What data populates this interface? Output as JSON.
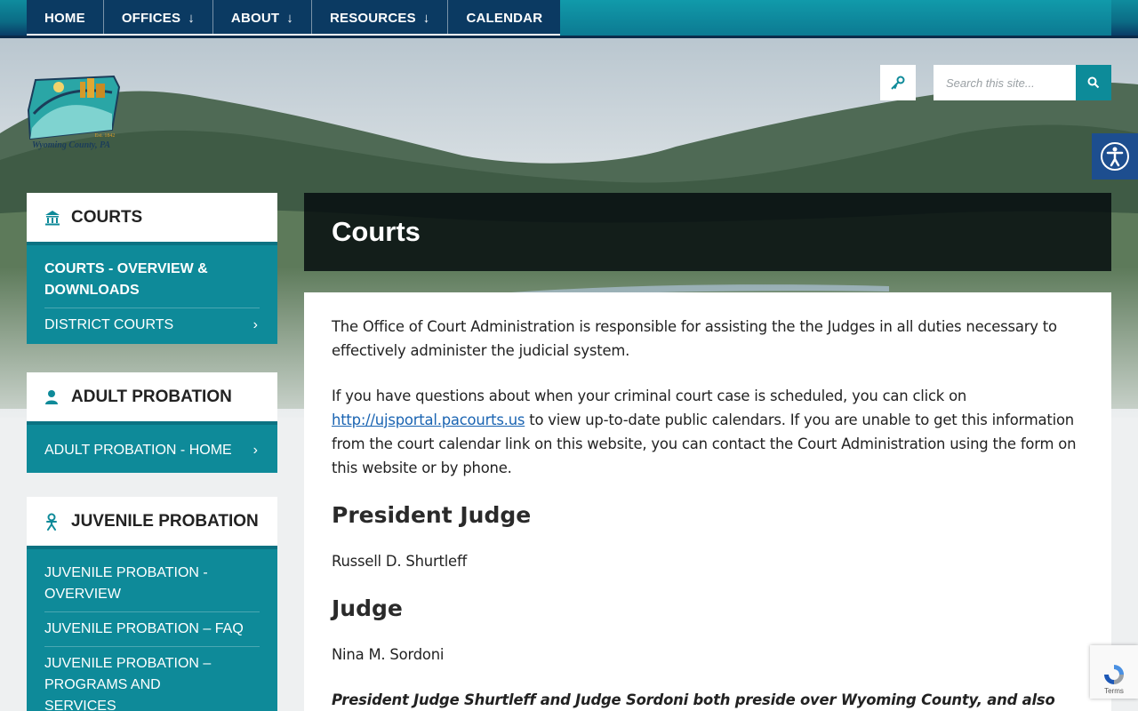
{
  "nav": {
    "items": [
      {
        "label": "HOME",
        "dropdown": false
      },
      {
        "label": "OFFICES",
        "dropdown": true
      },
      {
        "label": "ABOUT",
        "dropdown": true
      },
      {
        "label": "RESOURCES",
        "dropdown": true
      },
      {
        "label": "CALENDAR",
        "dropdown": false
      }
    ]
  },
  "logo": {
    "text": "Wyoming County, PA",
    "est": "Est. 1842"
  },
  "search": {
    "placeholder": "Search this site..."
  },
  "sidebar": {
    "courts": {
      "heading": "COURTS",
      "icon": "courthouse-icon",
      "links": [
        {
          "label": "COURTS - OVERVIEW & DOWNLOADS",
          "active": true
        },
        {
          "label": "DISTRICT COURTS",
          "active": false,
          "chevron": true
        }
      ]
    },
    "adult_probation": {
      "heading": "ADULT PROBATION",
      "icon": "user-icon",
      "links": [
        {
          "label": "ADULT PROBATION - HOME",
          "chevron": true
        }
      ]
    },
    "juvenile_probation": {
      "heading": "JUVENILE PROBATION",
      "icon": "person-icon",
      "links": [
        {
          "label": "JUVENILE PROBATION - OVERVIEW"
        },
        {
          "label": "JUVENILE PROBATION – FAQ"
        },
        {
          "label": "JUVENILE PROBATION – PROGRAMS AND SERVICES"
        }
      ]
    }
  },
  "page": {
    "title": "Courts",
    "intro": "The Office of Court Administration is responsible for assisting the the Judges in all duties necessary to effectively administer the judicial system.",
    "para2_before": "If you have questions about when your criminal court case is scheduled, you can click on ",
    "para2_link": "http://ujsportal.pacourts.us",
    "para2_after": " to view up-to-date public calendars. If you are unable to get this information from the court calendar link on this website, you can contact the Court Administration using the form on this website or by phone.",
    "president_heading": "President Judge",
    "president_name": "Russell D. Shurtleff",
    "judge_heading": "Judge",
    "judge_name": "Nina M. Sordoni",
    "note": "President Judge Shurtleff and Judge Sordoni both preside over Wyoming County, and also neighboring"
  },
  "recaptcha": {
    "text": "Terms"
  },
  "colors": {
    "teal": "#0e8a99",
    "navy": "#0b3a62",
    "accessibility": "#1d4e8f"
  }
}
